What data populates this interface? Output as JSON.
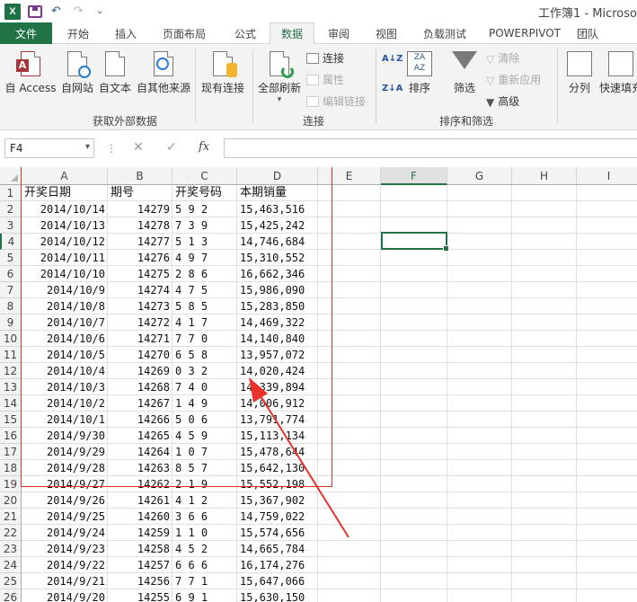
{
  "titlebar": {
    "logo": "X",
    "undo": "↶",
    "redo": "↷",
    "more": "⌄",
    "title": "工作簿1 - Microso"
  },
  "tabs": [
    "文件",
    "开始",
    "插入",
    "页面布局",
    "公式",
    "数据",
    "审阅",
    "视图",
    "负载测试",
    "POWERPIVOT",
    "团队"
  ],
  "active_tab": "数据",
  "ribbon": {
    "get_external": {
      "label": "获取外部数据",
      "buttons": [
        "自 Access",
        "自网站",
        "自文本",
        "自其他来源",
        "现有连接"
      ],
      "access_mark": "A"
    },
    "connections": {
      "label": "连接",
      "refresh_all": "全部刷新",
      "items": [
        "连接",
        "属性",
        "编辑链接"
      ]
    },
    "sort_filter": {
      "label": "排序和筛选",
      "sort_az": "A↓Z",
      "sort_za": "Z↓A",
      "sort": "排序",
      "filter": "筛选",
      "clear": "清除",
      "reapply": "重新应用",
      "advanced": "高级"
    },
    "tools": {
      "split": "分列",
      "flash_fill": "快速填充"
    }
  },
  "formula_bar": {
    "name_box": "F4",
    "dots": "⋮",
    "cancel": "✕",
    "enter": "✓",
    "fx": "fx",
    "value": ""
  },
  "columns": [
    "A",
    "B",
    "C",
    "D",
    "E",
    "F",
    "G",
    "H",
    "I"
  ],
  "selected_column": "F",
  "rows": [
    "1",
    "2",
    "3",
    "4",
    "5",
    "6",
    "7",
    "8",
    "9",
    "10",
    "11",
    "12",
    "13",
    "14",
    "15",
    "16",
    "17",
    "18",
    "19",
    "20",
    "21",
    "22",
    "23",
    "24",
    "25",
    "26"
  ],
  "header_row": [
    "开奖日期",
    "期号",
    "开奖号码",
    "本期销量"
  ],
  "table": [
    [
      "2014/10/14",
      "14279",
      "5 9 2",
      "15,463,516"
    ],
    [
      "2014/10/13",
      "14278",
      "7 3 9",
      "15,425,242"
    ],
    [
      "2014/10/12",
      "14277",
      "5 1 3",
      "14,746,684"
    ],
    [
      "2014/10/11",
      "14276",
      "4 9 7",
      "15,310,552"
    ],
    [
      "2014/10/10",
      "14275",
      "2 8 6",
      "16,662,346"
    ],
    [
      "2014/10/9",
      "14274",
      "4 7 5",
      "15,986,090"
    ],
    [
      "2014/10/8",
      "14273",
      "5 8 5",
      "15,283,850"
    ],
    [
      "2014/10/7",
      "14272",
      "4 1 7",
      "14,469,322"
    ],
    [
      "2014/10/6",
      "14271",
      "7 7 0",
      "14,140,840"
    ],
    [
      "2014/10/5",
      "14270",
      "6 5 8",
      "13,957,072"
    ],
    [
      "2014/10/4",
      "14269",
      "0 3 2",
      "14,020,424"
    ],
    [
      "2014/10/3",
      "14268",
      "7 4 0",
      "14,339,894"
    ],
    [
      "2014/10/2",
      "14267",
      "1 4 9",
      "14,006,912"
    ],
    [
      "2014/10/1",
      "14266",
      "5 0 6",
      "13,791,774"
    ],
    [
      "2014/9/30",
      "14265",
      "4 5 9",
      "15,113,134"
    ],
    [
      "2014/9/29",
      "14264",
      "1 0 7",
      "15,478,644"
    ],
    [
      "2014/9/28",
      "14263",
      "8 5 7",
      "15,642,130"
    ],
    [
      "2014/9/27",
      "14262",
      "2 1 9",
      "15,552,198"
    ],
    [
      "2014/9/26",
      "14261",
      "4 1 2",
      "15,367,902"
    ],
    [
      "2014/9/25",
      "14260",
      "3 6 6",
      "14,759,022"
    ],
    [
      "2014/9/24",
      "14259",
      "1 1 0",
      "15,574,656"
    ],
    [
      "2014/9/23",
      "14258",
      "4 5 2",
      "14,665,784"
    ],
    [
      "2014/9/22",
      "14257",
      "6 6 6",
      "16,174,276"
    ],
    [
      "2014/9/21",
      "14256",
      "7 7 1",
      "15,647,066"
    ],
    [
      "2014/9/20",
      "14255",
      "6 9 1",
      "15,630,150"
    ]
  ]
}
